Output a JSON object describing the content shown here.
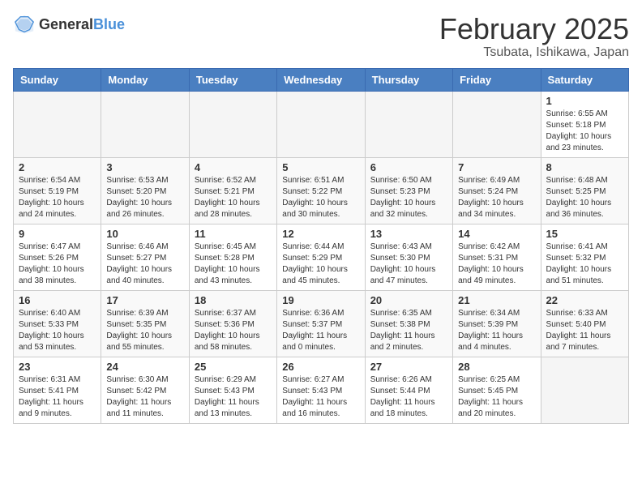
{
  "header": {
    "logo_general": "General",
    "logo_blue": "Blue",
    "title": "February 2025",
    "location": "Tsubata, Ishikawa, Japan"
  },
  "days_of_week": [
    "Sunday",
    "Monday",
    "Tuesday",
    "Wednesday",
    "Thursday",
    "Friday",
    "Saturday"
  ],
  "weeks": [
    [
      {
        "day": "",
        "info": ""
      },
      {
        "day": "",
        "info": ""
      },
      {
        "day": "",
        "info": ""
      },
      {
        "day": "",
        "info": ""
      },
      {
        "day": "",
        "info": ""
      },
      {
        "day": "",
        "info": ""
      },
      {
        "day": "1",
        "info": "Sunrise: 6:55 AM\nSunset: 5:18 PM\nDaylight: 10 hours\nand 23 minutes."
      }
    ],
    [
      {
        "day": "2",
        "info": "Sunrise: 6:54 AM\nSunset: 5:19 PM\nDaylight: 10 hours\nand 24 minutes."
      },
      {
        "day": "3",
        "info": "Sunrise: 6:53 AM\nSunset: 5:20 PM\nDaylight: 10 hours\nand 26 minutes."
      },
      {
        "day": "4",
        "info": "Sunrise: 6:52 AM\nSunset: 5:21 PM\nDaylight: 10 hours\nand 28 minutes."
      },
      {
        "day": "5",
        "info": "Sunrise: 6:51 AM\nSunset: 5:22 PM\nDaylight: 10 hours\nand 30 minutes."
      },
      {
        "day": "6",
        "info": "Sunrise: 6:50 AM\nSunset: 5:23 PM\nDaylight: 10 hours\nand 32 minutes."
      },
      {
        "day": "7",
        "info": "Sunrise: 6:49 AM\nSunset: 5:24 PM\nDaylight: 10 hours\nand 34 minutes."
      },
      {
        "day": "8",
        "info": "Sunrise: 6:48 AM\nSunset: 5:25 PM\nDaylight: 10 hours\nand 36 minutes."
      }
    ],
    [
      {
        "day": "9",
        "info": "Sunrise: 6:47 AM\nSunset: 5:26 PM\nDaylight: 10 hours\nand 38 minutes."
      },
      {
        "day": "10",
        "info": "Sunrise: 6:46 AM\nSunset: 5:27 PM\nDaylight: 10 hours\nand 40 minutes."
      },
      {
        "day": "11",
        "info": "Sunrise: 6:45 AM\nSunset: 5:28 PM\nDaylight: 10 hours\nand 43 minutes."
      },
      {
        "day": "12",
        "info": "Sunrise: 6:44 AM\nSunset: 5:29 PM\nDaylight: 10 hours\nand 45 minutes."
      },
      {
        "day": "13",
        "info": "Sunrise: 6:43 AM\nSunset: 5:30 PM\nDaylight: 10 hours\nand 47 minutes."
      },
      {
        "day": "14",
        "info": "Sunrise: 6:42 AM\nSunset: 5:31 PM\nDaylight: 10 hours\nand 49 minutes."
      },
      {
        "day": "15",
        "info": "Sunrise: 6:41 AM\nSunset: 5:32 PM\nDaylight: 10 hours\nand 51 minutes."
      }
    ],
    [
      {
        "day": "16",
        "info": "Sunrise: 6:40 AM\nSunset: 5:33 PM\nDaylight: 10 hours\nand 53 minutes."
      },
      {
        "day": "17",
        "info": "Sunrise: 6:39 AM\nSunset: 5:35 PM\nDaylight: 10 hours\nand 55 minutes."
      },
      {
        "day": "18",
        "info": "Sunrise: 6:37 AM\nSunset: 5:36 PM\nDaylight: 10 hours\nand 58 minutes."
      },
      {
        "day": "19",
        "info": "Sunrise: 6:36 AM\nSunset: 5:37 PM\nDaylight: 11 hours\nand 0 minutes."
      },
      {
        "day": "20",
        "info": "Sunrise: 6:35 AM\nSunset: 5:38 PM\nDaylight: 11 hours\nand 2 minutes."
      },
      {
        "day": "21",
        "info": "Sunrise: 6:34 AM\nSunset: 5:39 PM\nDaylight: 11 hours\nand 4 minutes."
      },
      {
        "day": "22",
        "info": "Sunrise: 6:33 AM\nSunset: 5:40 PM\nDaylight: 11 hours\nand 7 minutes."
      }
    ],
    [
      {
        "day": "23",
        "info": "Sunrise: 6:31 AM\nSunset: 5:41 PM\nDaylight: 11 hours\nand 9 minutes."
      },
      {
        "day": "24",
        "info": "Sunrise: 6:30 AM\nSunset: 5:42 PM\nDaylight: 11 hours\nand 11 minutes."
      },
      {
        "day": "25",
        "info": "Sunrise: 6:29 AM\nSunset: 5:43 PM\nDaylight: 11 hours\nand 13 minutes."
      },
      {
        "day": "26",
        "info": "Sunrise: 6:27 AM\nSunset: 5:43 PM\nDaylight: 11 hours\nand 16 minutes."
      },
      {
        "day": "27",
        "info": "Sunrise: 6:26 AM\nSunset: 5:44 PM\nDaylight: 11 hours\nand 18 minutes."
      },
      {
        "day": "28",
        "info": "Sunrise: 6:25 AM\nSunset: 5:45 PM\nDaylight: 11 hours\nand 20 minutes."
      },
      {
        "day": "",
        "info": ""
      }
    ]
  ]
}
